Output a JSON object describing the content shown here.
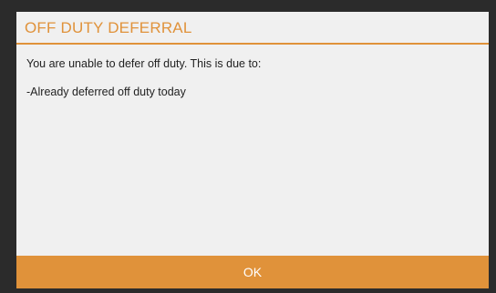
{
  "dialog": {
    "title": "OFF DUTY DEFERRAL",
    "message": "You are unable to defer off duty. This is due to:",
    "reasons": [
      "-Already deferred off duty today"
    ],
    "ok_label": "OK"
  },
  "colors": {
    "accent": "#e0923a",
    "dialog_background": "#f0f0f0",
    "frame_background": "#2b2b2b",
    "text": "#222222",
    "button_text": "#ffffff"
  }
}
